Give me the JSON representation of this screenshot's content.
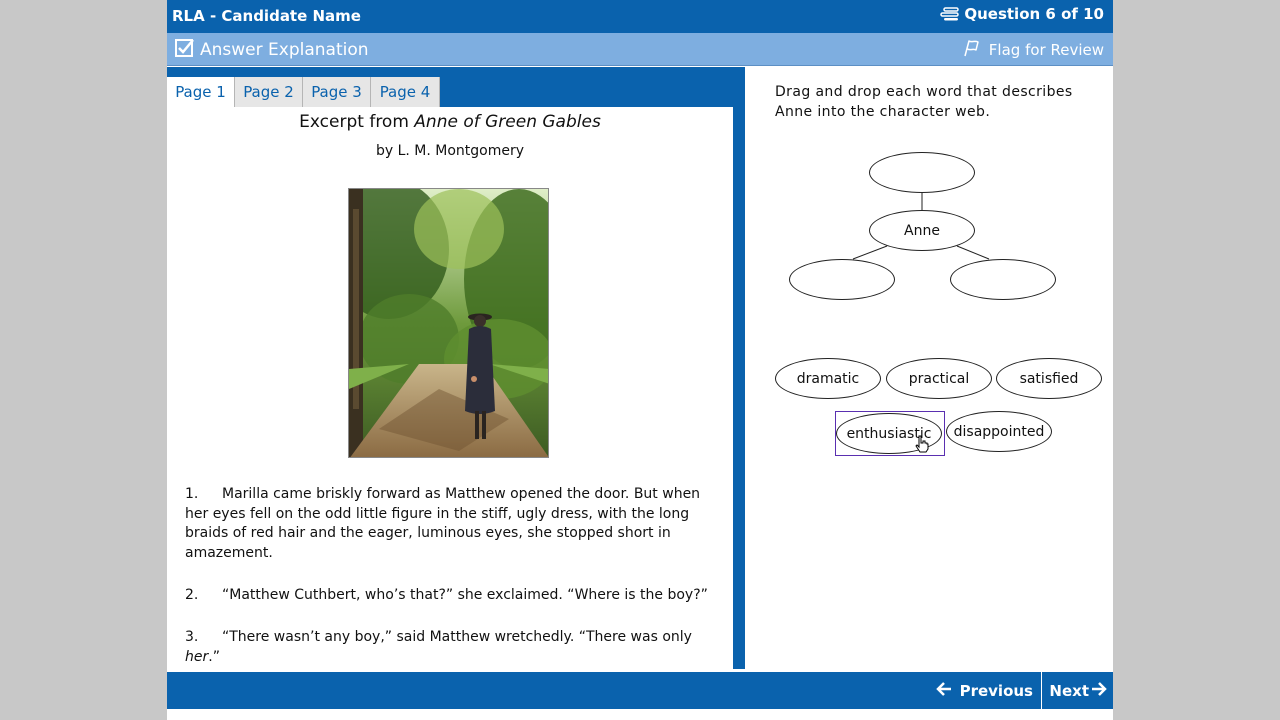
{
  "header": {
    "app_title": "RLA - Candidate Name",
    "question_counter": "Question 6 of 10",
    "question_counter_icon": "question-list-icon"
  },
  "toolbar": {
    "explanation_label": "Answer Explanation",
    "explanation_icon": "checkbox-icon",
    "flag_label": "Flag for Review",
    "flag_icon": "flag-icon"
  },
  "passage": {
    "tabs": [
      {
        "label": "Page 1",
        "active": true
      },
      {
        "label": "Page 2",
        "active": false
      },
      {
        "label": "Page 3",
        "active": false
      },
      {
        "label": "Page 4",
        "active": false
      }
    ],
    "title_prefix": "Excerpt from ",
    "title_italic": "Anne of Green Gables",
    "author": "by L. M. Montgomery",
    "paragraphs": [
      {
        "number": "1.",
        "text": "Marilla came briskly forward as Matthew opened the door. But when her eyes fell on the odd little figure in the stiff, ugly dress, with the long braids of red hair and the eager, luminous eyes, she stopped short in amazement."
      },
      {
        "number": "2.",
        "text": "“Matthew Cuthbert, who’s that?” she exclaimed. “Where is the boy?”"
      },
      {
        "number": "3.",
        "text_before_italic": "“There wasn’t any boy,” said Matthew wretchedly. “There was only ",
        "text_italic": "her",
        "text_after_italic": ".”"
      }
    ]
  },
  "question": {
    "prompt": "Drag and drop each word that describes Anne into the character web.",
    "center_label": "Anne",
    "words": [
      "dramatic",
      "practical",
      "satisfied",
      "enthusiastic",
      "disappointed"
    ],
    "selected_word": "enthusiastic"
  },
  "footer": {
    "previous_label": "Previous",
    "next_label": "Next"
  },
  "colors": {
    "primary_blue": "#0a62ad",
    "light_blue": "#7eaee0",
    "selection_purple": "#5a2fb0",
    "frame_gray": "#c8c8c8"
  }
}
